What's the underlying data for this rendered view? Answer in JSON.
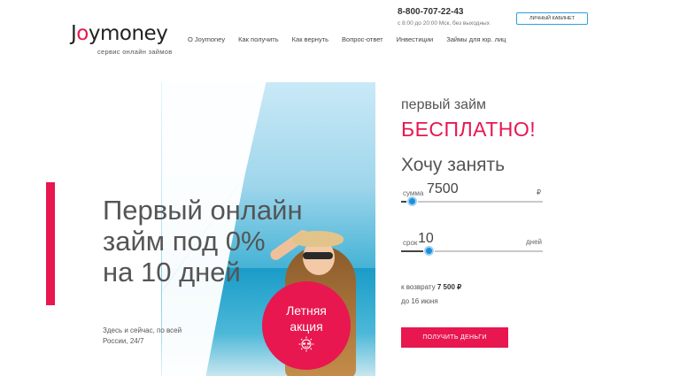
{
  "header": {
    "logo_prefix": "J",
    "logo_o": "o",
    "logo_rest": "ymoney",
    "tagline": "сервис онлайн займов",
    "nav": [
      "О Joymoney",
      "Как получить",
      "Как вернуть",
      "Вопрос-ответ",
      "Инвестиции",
      "Займы для юр. лиц"
    ],
    "phone": "8-800-707-22-43",
    "hours": "с 8:00 до 20:00 Мск, без выходных",
    "cabinet_label": "Личный кабинет"
  },
  "hero": {
    "headline": [
      "Первый онлайн",
      "займ под 0%",
      "на 10 дней"
    ],
    "subtext": "Здесь и сейчас, по всей России, 24/7",
    "promo_line1": "Летняя",
    "promo_line2": "акция"
  },
  "form": {
    "first_loan": "первый займ",
    "free": "БЕСПЛАТНО!",
    "want": "Хочу занять",
    "amount": {
      "label": "сумма",
      "value": "7500",
      "unit": "₽",
      "fill": 0.08
    },
    "term": {
      "label": "срок",
      "value": "10",
      "unit": "дней",
      "fill": 0.2
    },
    "return_label": "к возврату",
    "return_amount": "7 500 ₽",
    "due_date": "до 16 июня",
    "submit_label": "получить деньги"
  },
  "colors": {
    "accent": "#e8174f",
    "slider_knob": "#1e8fd6",
    "cabinet_border": "#2c9fe3"
  },
  "icons": [
    "sun-sunglasses-icon"
  ]
}
